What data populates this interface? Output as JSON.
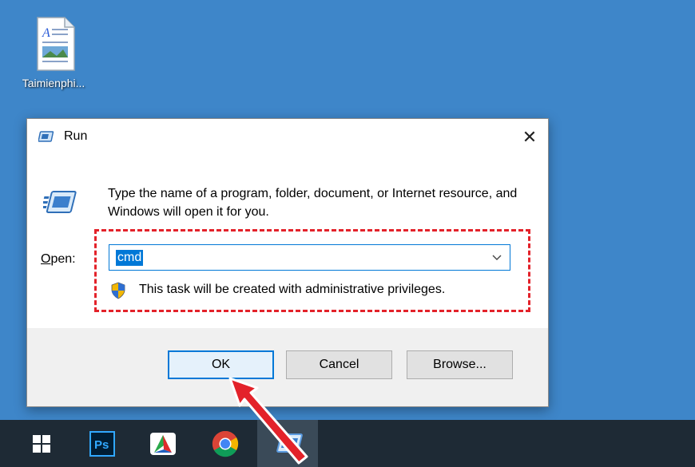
{
  "desktop": {
    "icon_label": "Taimienphi..."
  },
  "dialog": {
    "title": "Run",
    "close_glyph": "✕",
    "description": "Type the name of a program, folder, document, or Internet resource, and Windows will open it for you.",
    "open_label_accesskey": "O",
    "open_label_rest": "pen:",
    "open_value": "cmd",
    "admin_notice": "This task will be created with administrative privileges.",
    "buttons": {
      "ok": "OK",
      "cancel": "Cancel",
      "browse": "Browse..."
    }
  },
  "taskbar": {
    "items": [
      "start-icon",
      "photoshop-icon",
      "app-icon",
      "chrome-icon",
      "run-icon"
    ],
    "photoshop_text": "Ps"
  },
  "colors": {
    "desktop_bg": "#3e86c9",
    "taskbar_bg": "#1e2a35",
    "accent": "#0078d7",
    "highlight": "#e3222a"
  }
}
